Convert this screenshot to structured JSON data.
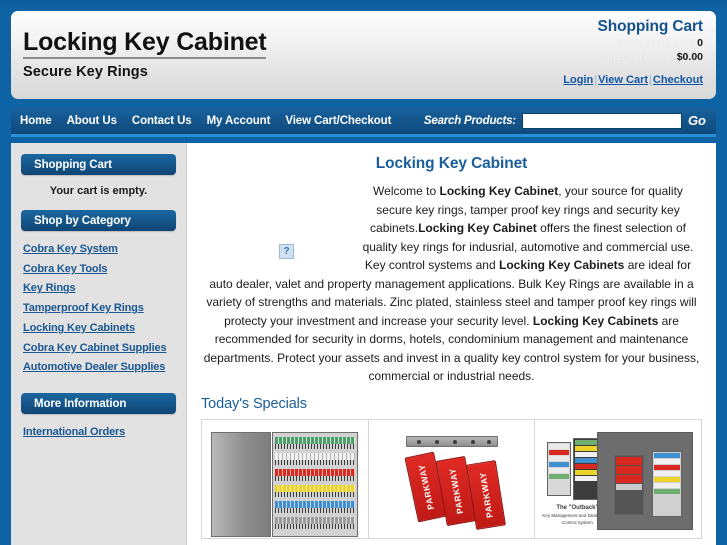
{
  "site": {
    "logo_title": "Locking Key Cabinet",
    "logo_subtitle": "Secure Key Rings",
    "accent_blue": "#0e63a4",
    "panel_blue": "#15578c",
    "link_blue": "#1a5791",
    "heading_blue": "#1b5e9b"
  },
  "cart_summary": {
    "title": "Shopping Cart",
    "items_label": "Items in my cart:",
    "items_count": "0",
    "subtotal_label": "Current subtotal:",
    "subtotal_value": "$0.00",
    "links": [
      {
        "label": "Login",
        "name": "login-link"
      },
      {
        "label": "View Cart",
        "name": "view-cart-link"
      },
      {
        "label": "Checkout",
        "name": "checkout-link"
      }
    ]
  },
  "nav": {
    "items": [
      {
        "label": "Home",
        "name": "nav-home"
      },
      {
        "label": "About Us",
        "name": "nav-about-us"
      },
      {
        "label": "Contact Us",
        "name": "nav-contact-us"
      },
      {
        "label": "My Account",
        "name": "nav-my-account"
      },
      {
        "label": "View Cart/Checkout",
        "name": "nav-view-cart-checkout"
      }
    ],
    "search_label": "Search Products:",
    "search_value": "",
    "search_placeholder": "",
    "go_label": "Go"
  },
  "sidebar": {
    "cart_panel_title": "Shopping Cart",
    "cart_empty_text": "Your cart is empty.",
    "category_panel_title": "Shop by Category",
    "categories": [
      {
        "label": "Cobra Key System"
      },
      {
        "label": "Cobra Key Tools"
      },
      {
        "label": "Key Rings"
      },
      {
        "label": "Tamperproof Key Rings"
      },
      {
        "label": "Locking Key Cabinets"
      },
      {
        "label": "Cobra Key Cabinet Supplies"
      },
      {
        "label": "Automotive Dealer Supplies"
      }
    ],
    "info_panel_title": "More Information",
    "info_links": [
      {
        "label": "International Orders"
      }
    ]
  },
  "main": {
    "page_title": "Locking Key Cabinet",
    "broken_image_alt": "?",
    "intro_parts": {
      "p1": "Welcome to ",
      "b1": "Locking Key Cabinet",
      "p2": ", your source for quality secure key rings, tamper proof key rings and security key cabinets.",
      "b2": "Locking Key Cabinet",
      "p3": " offers the finest selection of quality key rings for indusrial, automotive and commercial use. Key control systems and ",
      "b3": "Locking Key Cabinets",
      "p4": " are ideal for auto dealer, valet and property management applications. Bulk Key Rings are available in a variety of strengths and materials. Zinc plated, stainless steel and tamper proof key rings will protecty your investment and increase your security level. ",
      "b4": "Locking Key Cabinets",
      "p5": " are recommended for security in dorms, hotels, condominium management and maintenance departments. Protect your assets and invest in a quality key control system for your business, commercial or industrial needs."
    },
    "specials_title": "Today's Specials",
    "specials": [
      {
        "name": "special-key-cabinet",
        "caption": ""
      },
      {
        "name": "special-parkway-tags",
        "caption": "PARKWAY"
      },
      {
        "name": "special-outback-system",
        "caption": "The \"Outback\"",
        "subcaption": "Key Management and Dealer Plate Control System"
      }
    ]
  }
}
